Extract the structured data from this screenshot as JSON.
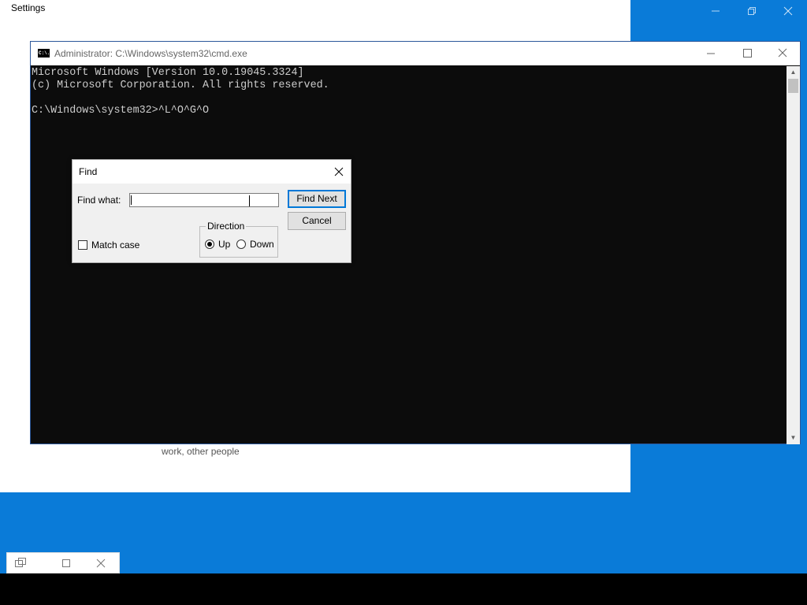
{
  "settings": {
    "title": "Settings",
    "partial_text": "work, other people"
  },
  "cmd": {
    "title": "Administrator: C:\\Windows\\system32\\cmd.exe",
    "icon_label": "C:\\.",
    "lines": [
      "Microsoft Windows [Version 10.0.19045.3324]",
      "(c) Microsoft Corporation. All rights reserved.",
      "",
      "C:\\Windows\\system32>^L^O^G^O"
    ]
  },
  "find": {
    "title": "Find",
    "find_what_label": "Find what:",
    "find_what_value": "",
    "find_next_label": "Find Next",
    "cancel_label": "Cancel",
    "match_case_label": "Match case",
    "match_case_checked": false,
    "direction_label": "Direction",
    "up_label": "Up",
    "down_label": "Down",
    "direction_selected": "Up"
  },
  "colors": {
    "desktop": "#0a7bd8",
    "console_bg": "#0c0c0c",
    "console_text": "#cccccc",
    "accent": "#0078d7"
  }
}
